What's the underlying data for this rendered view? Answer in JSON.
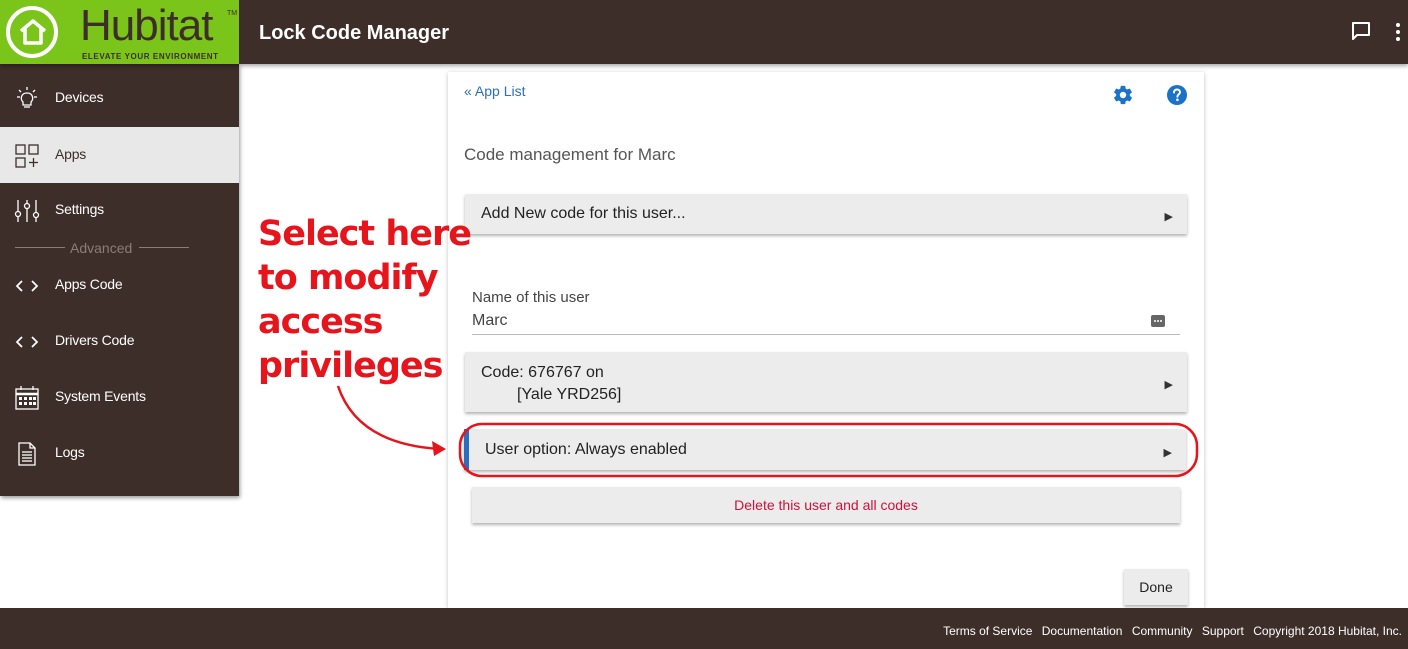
{
  "header": {
    "logo_name": "Hubitat",
    "logo_tm": "TM",
    "logo_tagline": "ELEVATE YOUR ENVIRONMENT",
    "title": "Lock Code Manager",
    "icons": [
      "chat-icon",
      "more-vert-icon"
    ]
  },
  "sidebar": {
    "advanced_label": "Advanced",
    "items": [
      {
        "label": "Devices",
        "icon": "bulb-icon"
      },
      {
        "label": "Apps",
        "icon": "apps-grid-icon",
        "active": true
      },
      {
        "label": "Settings",
        "icon": "sliders-icon"
      },
      {
        "label": "Apps Code",
        "icon": "code-icon"
      },
      {
        "label": "Drivers Code",
        "icon": "code-icon"
      },
      {
        "label": "System Events",
        "icon": "calendar-icon"
      },
      {
        "label": "Logs",
        "icon": "document-icon"
      }
    ]
  },
  "page": {
    "back_link": "« App List",
    "section_title": "Code management for Marc",
    "add_code_label": "Add New code for this user...",
    "name_label": "Name of this user",
    "name_value": "Marc",
    "code_line1": "Code: 676767 on",
    "code_line2": "[Yale YRD256]",
    "user_option_label": "User option: Always enabled",
    "delete_label": "Delete this user and all codes",
    "done_label": "Done",
    "arrow_glyph": "▶"
  },
  "annotation": {
    "lines": [
      "Select here",
      "to modify",
      "access",
      "privileges"
    ],
    "color": "#e8141c"
  },
  "footer": {
    "links": [
      "Terms of Service",
      "Documentation",
      "Community",
      "Support"
    ],
    "copyright": "Copyright 2018 Hubitat, Inc."
  },
  "colors": {
    "header_bg": "#3e2e2a",
    "logo_green": "#7bc51a",
    "link_blue": "#2b6dbf",
    "accent_bar": "#2b6dbf",
    "delete_red": "#d0103a"
  }
}
